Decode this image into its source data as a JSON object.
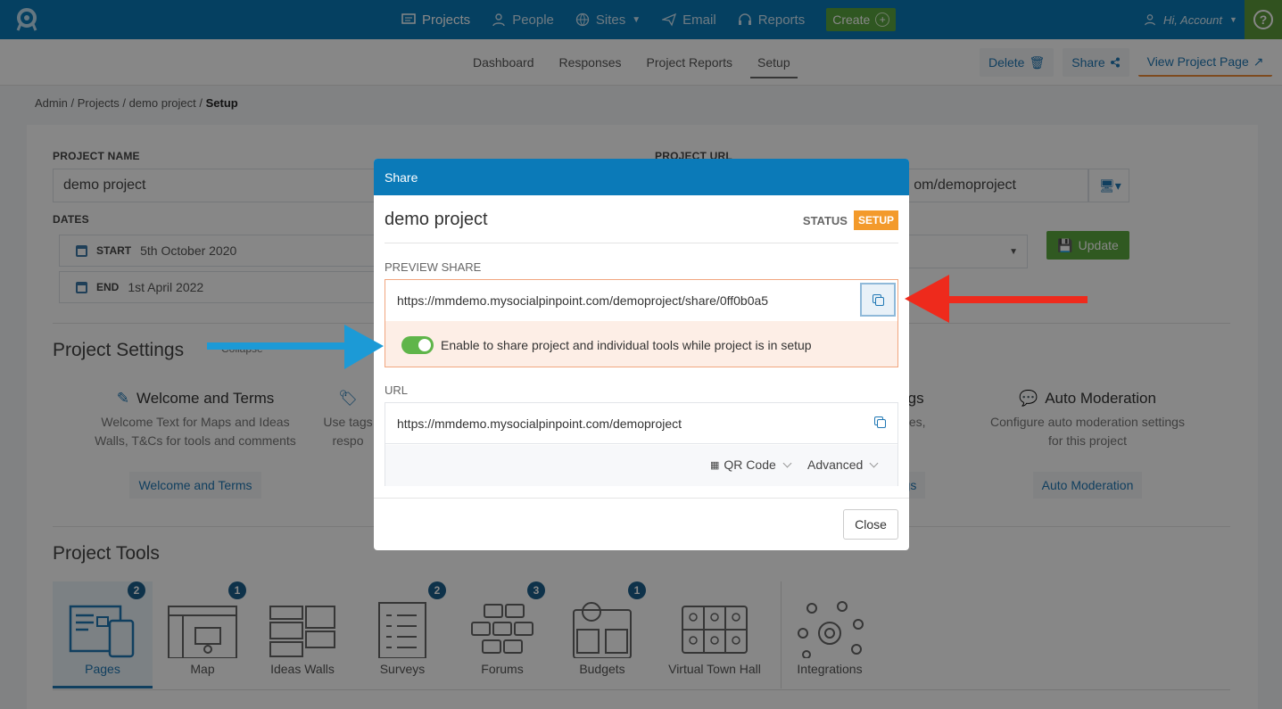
{
  "nav": {
    "items": [
      {
        "label": "Projects",
        "icon": "projects-icon"
      },
      {
        "label": "People",
        "icon": "person-icon"
      },
      {
        "label": "Sites",
        "icon": "globe-icon"
      },
      {
        "label": "Email",
        "icon": "send-icon"
      },
      {
        "label": "Reports",
        "icon": "headset-icon"
      }
    ],
    "create_label": "Create",
    "account_label": "Hi, Account"
  },
  "subnav": {
    "tabs": [
      "Dashboard",
      "Responses",
      "Project Reports",
      "Setup"
    ],
    "active_tab": "Setup",
    "delete_label": "Delete",
    "share_label": "Share",
    "view_label": "View Project Page"
  },
  "breadcrumb": {
    "items": [
      "Admin",
      "Projects",
      "demo project"
    ],
    "current": "Setup",
    "separator": "/"
  },
  "form": {
    "project_name_label": "PROJECT NAME",
    "project_name_value": "demo project",
    "project_url_label": "PROJECT URL",
    "project_url_value": "om/demoproject",
    "dates_label": "DATES",
    "start_label": "START",
    "start_value": "5th October 2020",
    "end_label": "END",
    "end_value": "1st April 2022",
    "update_label": "Update"
  },
  "settings": {
    "heading": "Project Settings",
    "collapse_label": "Collapse",
    "cards": [
      {
        "title": "Welcome and Terms",
        "desc1": "Welcome Text for Maps and Ideas",
        "desc2": "Walls, T&Cs for tools and comments",
        "button": "Welcome and Terms"
      },
      {
        "desc1": "Use tags",
        "desc2": "respo"
      },
      {
        "title": "ings",
        "desc1": "tures,",
        "button": "gs"
      },
      {
        "title": "Auto Moderation",
        "desc1": "Configure auto moderation settings",
        "desc2": "for this project",
        "button": "Auto Moderation"
      }
    ]
  },
  "tools": {
    "heading": "Project Tools",
    "items": [
      {
        "label": "Pages",
        "badge": "2"
      },
      {
        "label": "Map",
        "badge": "1"
      },
      {
        "label": "Ideas Walls",
        "badge": ""
      },
      {
        "label": "Surveys",
        "badge": "2"
      },
      {
        "label": "Forums",
        "badge": "3"
      },
      {
        "label": "Budgets",
        "badge": "1"
      },
      {
        "label": "Virtual Town Hall",
        "badge": ""
      },
      {
        "label": "Integrations",
        "badge": ""
      }
    ]
  },
  "modal": {
    "header": "Share",
    "title": "demo project",
    "status_label": "STATUS",
    "status_value": "SETUP",
    "preview_label": "PREVIEW SHARE",
    "preview_url": "https://mmdemo.mysocialpinpoint.com/demoproject/share/0ff0b0a5",
    "toggle_label": "Enable to share project and individual tools while project is in setup",
    "toggle_on": true,
    "url_label": "URL",
    "url_value": "https://mmdemo.mysocialpinpoint.com/demoproject",
    "qr_label": "QR Code",
    "advanced_label": "Advanced",
    "close_label": "Close"
  },
  "colors": {
    "brand": "#0b7ab8",
    "create_green": "#59a53f",
    "status_orange": "#f39a2b",
    "arrow_red": "#ee2a1c",
    "arrow_blue": "#1c9ad6"
  }
}
